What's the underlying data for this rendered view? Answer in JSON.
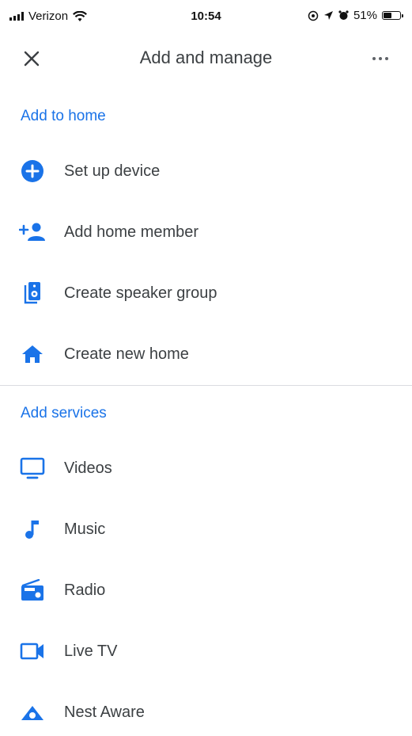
{
  "status_bar": {
    "carrier": "Verizon",
    "time": "10:54",
    "battery_percent": "51%",
    "battery_level": 0.51
  },
  "app_bar": {
    "title": "Add and manage"
  },
  "colors": {
    "accent": "#1a73e8",
    "text": "#3c4043",
    "divider": "#dadce0"
  },
  "sections": {
    "add_to_home": {
      "header": "Add to home",
      "items": [
        {
          "label": "Set up device",
          "icon": "add-circle-icon"
        },
        {
          "label": "Add home member",
          "icon": "person-add-icon"
        },
        {
          "label": "Create speaker group",
          "icon": "speaker-group-icon"
        },
        {
          "label": "Create new home",
          "icon": "home-icon"
        }
      ]
    },
    "add_services": {
      "header": "Add services",
      "items": [
        {
          "label": "Videos",
          "icon": "tv-icon"
        },
        {
          "label": "Music",
          "icon": "music-note-icon"
        },
        {
          "label": "Radio",
          "icon": "radio-icon"
        },
        {
          "label": "Live TV",
          "icon": "videocam-icon"
        },
        {
          "label": "Nest Aware",
          "icon": "nest-aware-icon"
        }
      ]
    }
  }
}
